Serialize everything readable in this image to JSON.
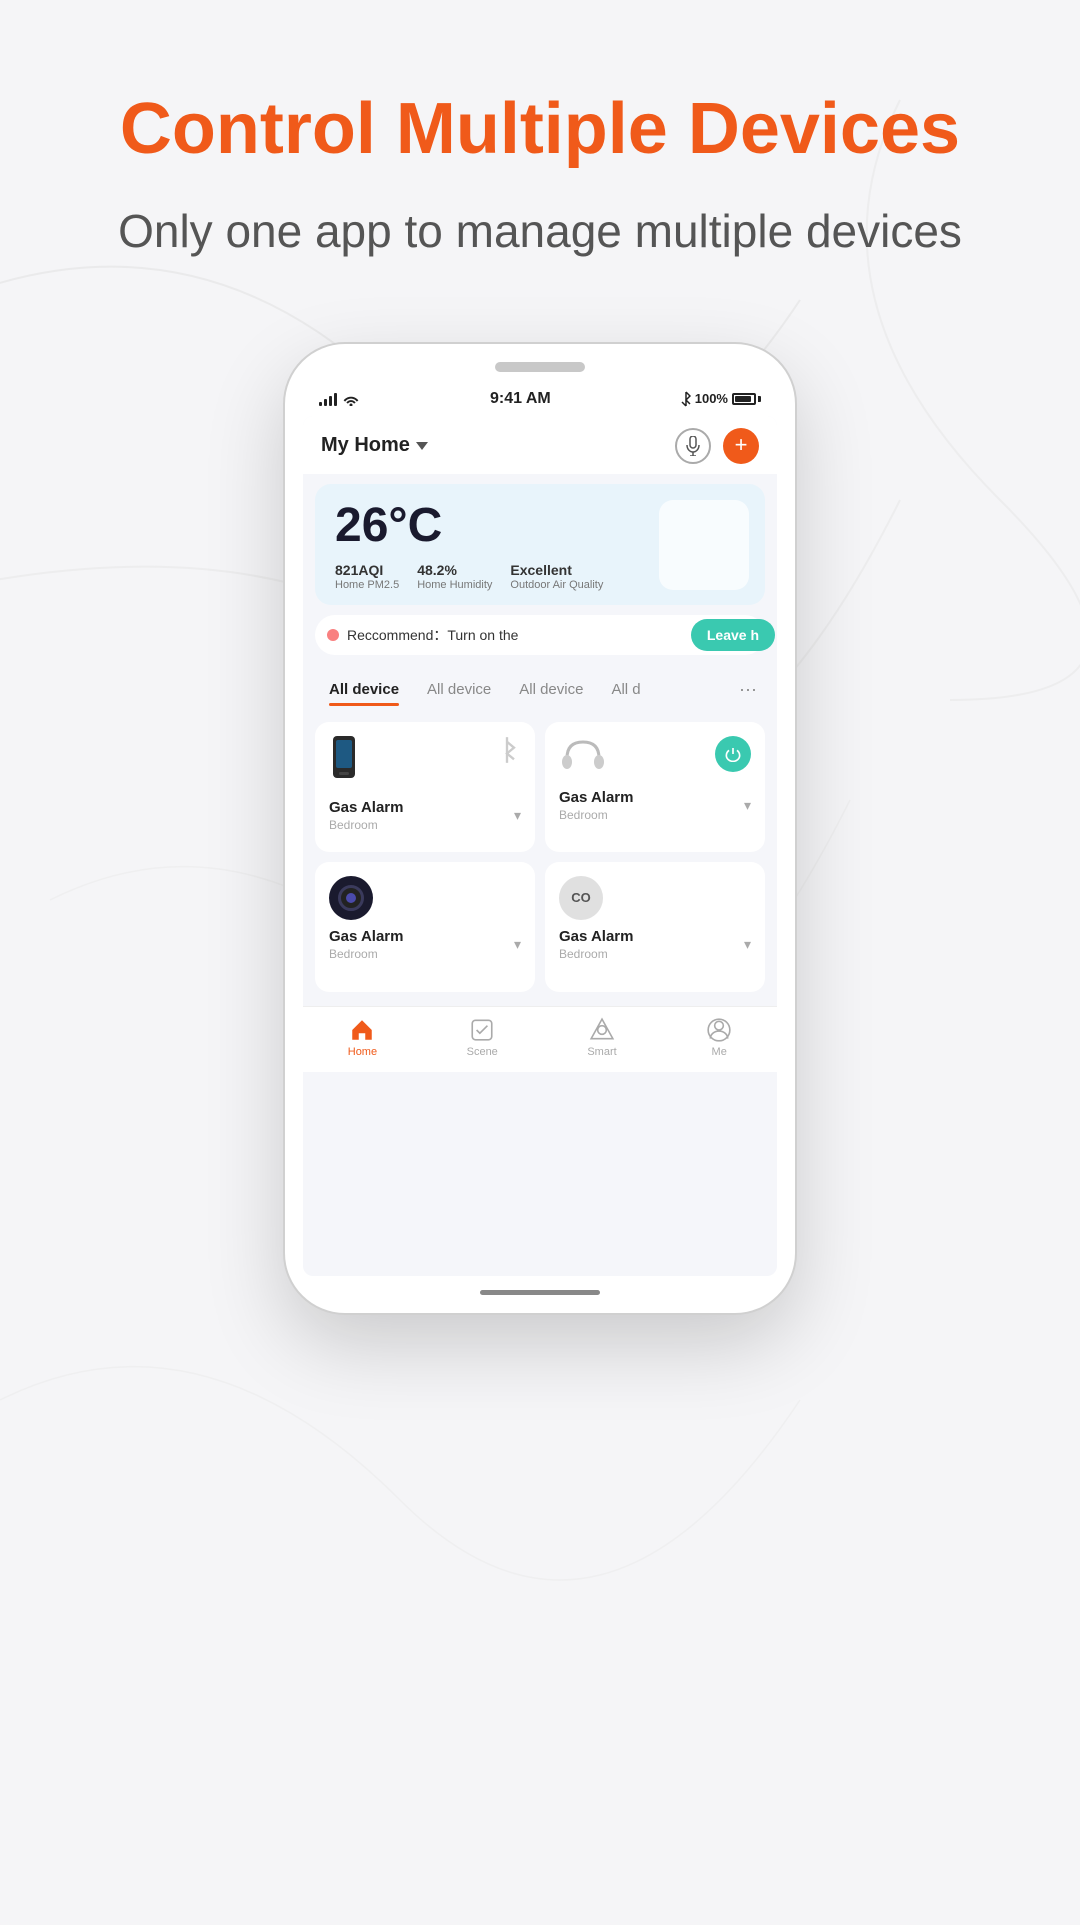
{
  "page": {
    "background_color": "#f5f5f7"
  },
  "hero": {
    "title": "Control Multiple Devices",
    "subtitle": "Only one app to manage multiple devices"
  },
  "phone": {
    "status_bar": {
      "time": "9:41 AM",
      "battery": "100%",
      "bluetooth": true
    },
    "topbar": {
      "home_name": "My Home",
      "mic_label": "microphone",
      "add_label": "add device"
    },
    "weather_card": {
      "temperature": "26°C",
      "stats": [
        {
          "value": "821AQI",
          "label": "Home PM2.5"
        },
        {
          "value": "48.2%",
          "label": "Home Humidity"
        },
        {
          "value": "Excellent",
          "label": "Outdoor Air Quality"
        }
      ]
    },
    "recommendation": {
      "text": "Reccommend：Turn on the",
      "button_label": "Leave h"
    },
    "tabs": [
      {
        "label": "All device",
        "active": true
      },
      {
        "label": "All device",
        "active": false
      },
      {
        "label": "All device",
        "active": false
      },
      {
        "label": "All d",
        "active": false
      }
    ],
    "devices": [
      {
        "name": "Gas Alarm",
        "room": "Bedroom",
        "type": "black_device",
        "status_icon": "bluetooth",
        "power_on": false
      },
      {
        "name": "Gas Alarm",
        "room": "Bedroom",
        "type": "headphones",
        "status_icon": "power",
        "power_on": true
      },
      {
        "name": "Gas Alarm",
        "room": "Bedroom",
        "type": "camera",
        "status_icon": "none",
        "power_on": false
      },
      {
        "name": "Gas Alarm",
        "room": "Bedroom",
        "type": "co",
        "status_icon": "none",
        "power_on": false
      }
    ],
    "bottom_nav": [
      {
        "label": "Home",
        "active": true,
        "icon": "home"
      },
      {
        "label": "Scene",
        "active": false,
        "icon": "scene"
      },
      {
        "label": "Smart",
        "active": false,
        "icon": "smart"
      },
      {
        "label": "Me",
        "active": false,
        "icon": "me"
      }
    ]
  }
}
